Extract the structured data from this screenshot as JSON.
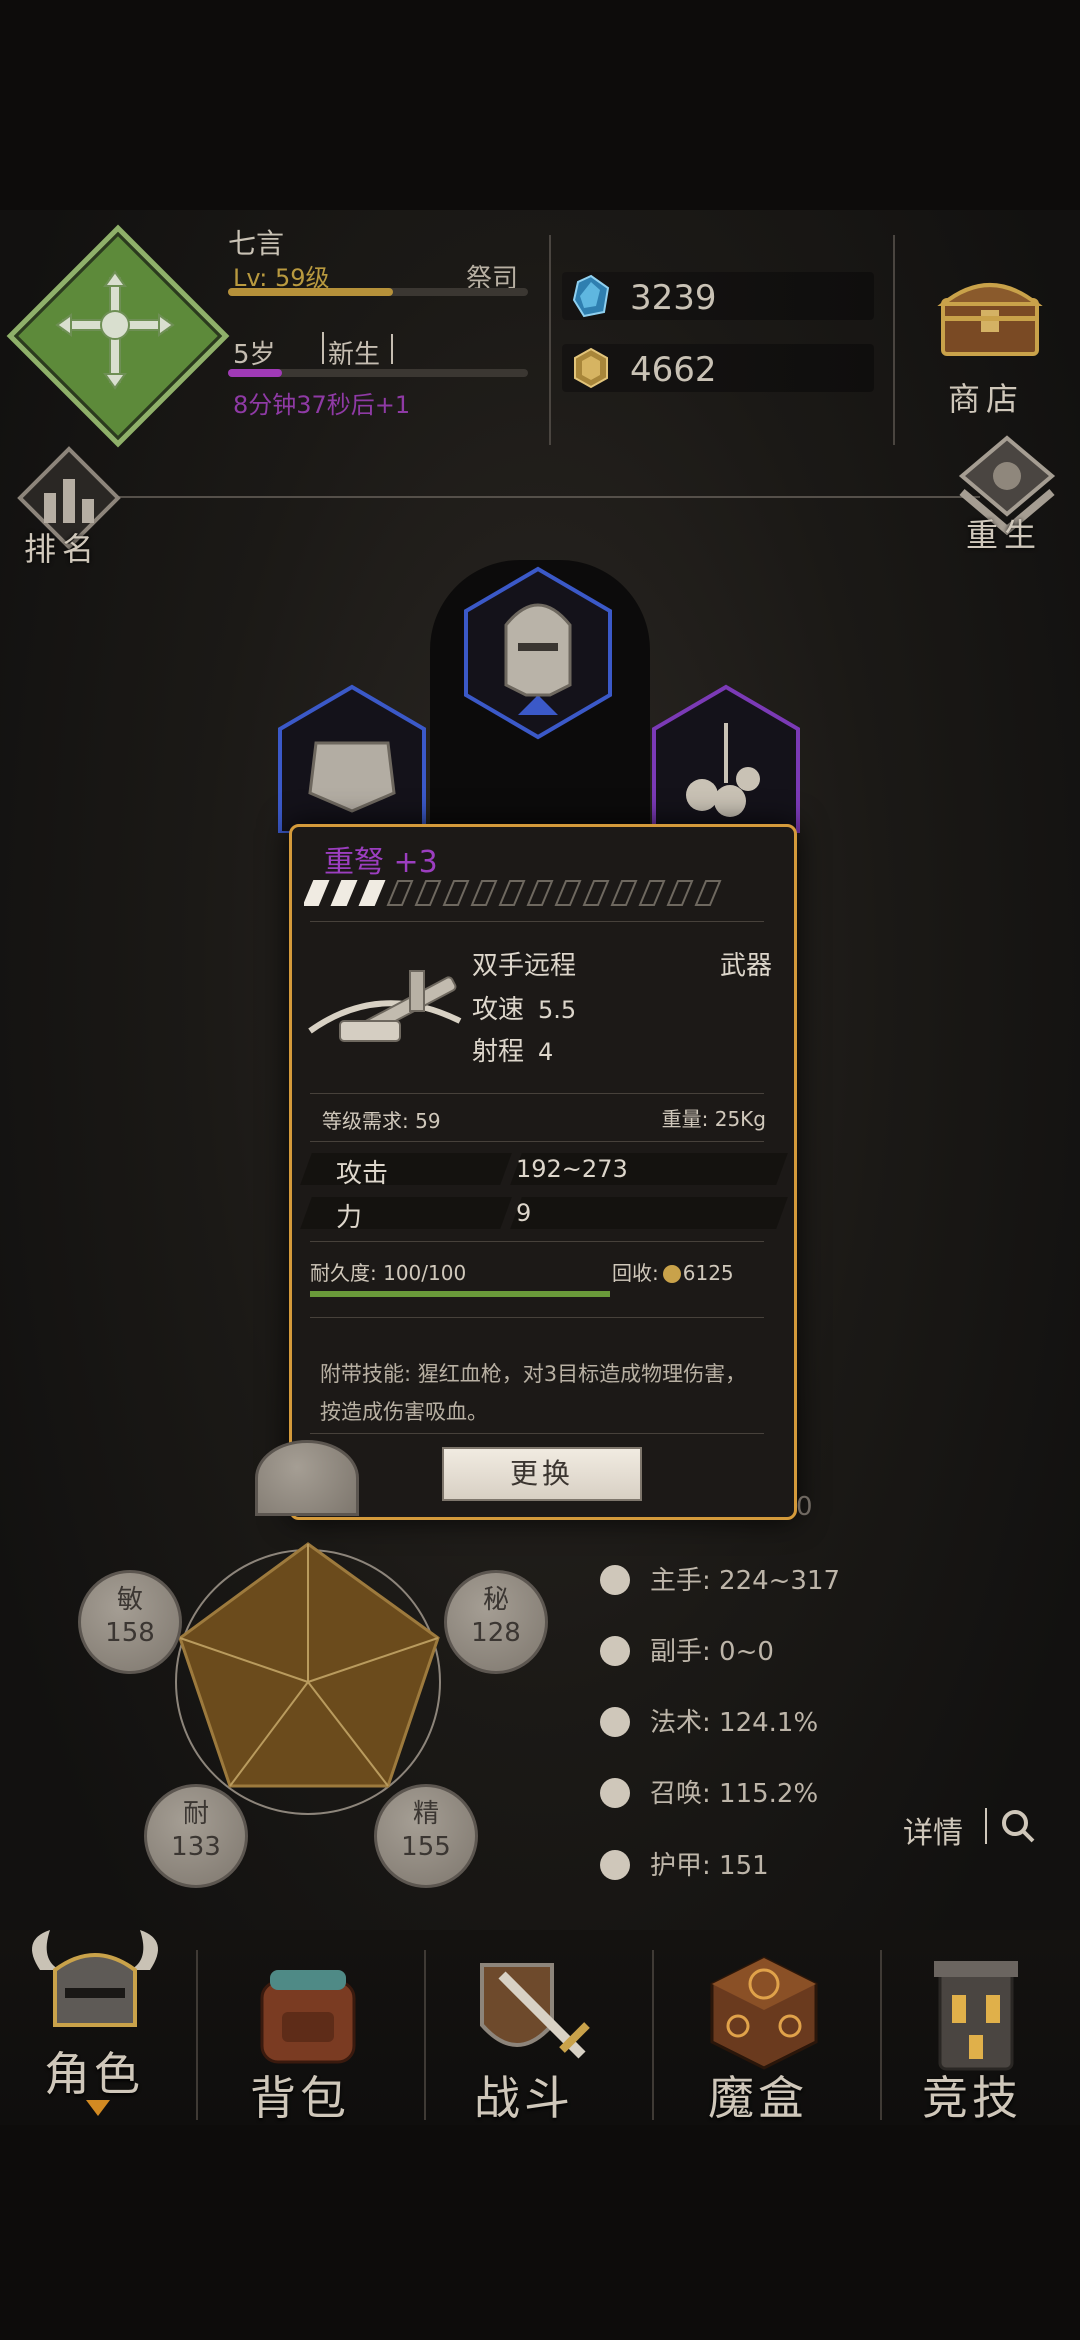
{
  "player": {
    "name": "七言",
    "level_text": "Lv: 59级",
    "class": "祭司",
    "level_progress": 0.55,
    "age": "5岁",
    "stage": "新生",
    "age_progress": 0.18,
    "timer": "8分钟37秒后+1"
  },
  "currency": {
    "gems": "3239",
    "gold": "4662"
  },
  "header_buttons": {
    "shop": "商店",
    "rank": "排名",
    "rebirth": "重生"
  },
  "item": {
    "name": "重弩 +3",
    "enhance_level": 3,
    "enhance_max": 15,
    "type": "双手远程",
    "slot": "武器",
    "attack_speed_label": "攻速",
    "attack_speed": "5.5",
    "range_label": "射程",
    "range": "4",
    "level_req": "等级需求: 59",
    "weight": "重量: 25Kg",
    "attrs": [
      {
        "label": "攻击",
        "value": "192~273"
      },
      {
        "label": "力",
        "value": "9"
      }
    ],
    "durability": "耐久度: 100/100",
    "durability_ratio": 1.0,
    "recycle_label": "回收:",
    "recycle_value": "6125",
    "skill": "附带技能: 猩红血枪，对3目标造成物理伤害，按造成伤害吸血。",
    "replace_button": "更换"
  },
  "stats": [
    {
      "name": "敏",
      "value": "158"
    },
    {
      "name": "秘",
      "value": "128"
    },
    {
      "name": "耐",
      "value": "133"
    },
    {
      "name": "精",
      "value": "155"
    }
  ],
  "hidden_partial_value": "0",
  "combat": [
    {
      "icon": "sword-icon",
      "text": "主手: 224~317"
    },
    {
      "icon": "offhand-icon",
      "text": "副手: 0~0"
    },
    {
      "icon": "lightning-icon",
      "text": "法术: 124.1%"
    },
    {
      "icon": "summon-icon",
      "text": "召唤: 115.2%"
    },
    {
      "icon": "armor-icon",
      "text": "护甲: 151"
    }
  ],
  "detail_button": "详情",
  "nav": [
    "角色",
    "背包",
    "战斗",
    "魔盒",
    "竞技"
  ],
  "colors": {
    "accent": "#d49a3b",
    "epic": "#9c3ec0",
    "level": "#b6913a",
    "age": "#a03ab6",
    "durability": "#6a9a3a"
  }
}
